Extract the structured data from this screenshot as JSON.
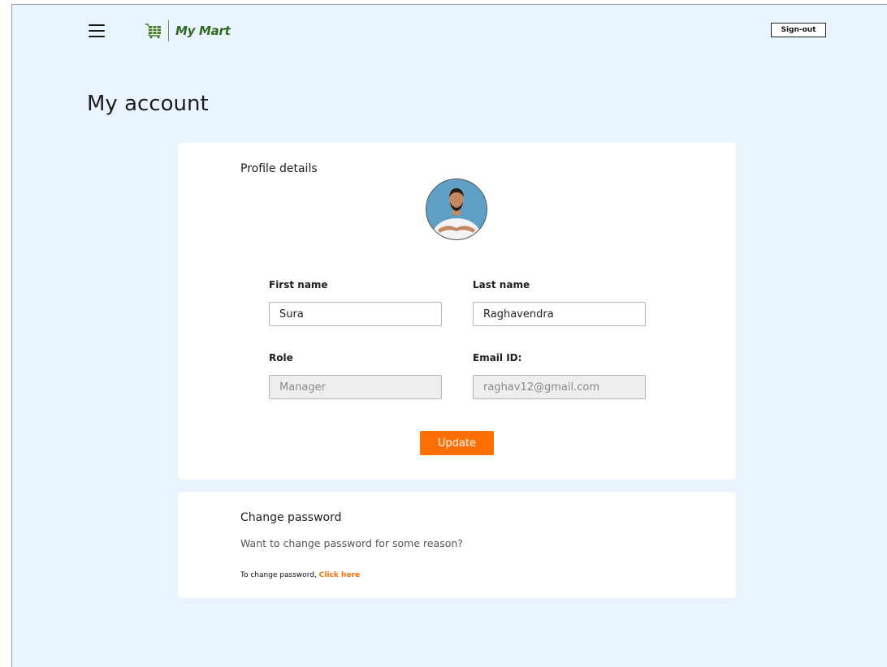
{
  "header": {
    "brand_name": "My Mart",
    "signout_label": "Sign-out",
    "icons": {
      "menu": "hamburger-icon",
      "logo": "shopping-cart-icon"
    },
    "colors": {
      "brand": "#2e6b1f"
    }
  },
  "page": {
    "title": "My account"
  },
  "profile": {
    "title": "Profile details",
    "avatar": "profile-photo",
    "fields": {
      "first_name": {
        "label": "First name",
        "value": "Sura"
      },
      "last_name": {
        "label": "Last name",
        "value": "Raghavendra"
      },
      "role": {
        "label": "Role",
        "value": "Manager"
      },
      "email": {
        "label": "Email ID:",
        "value": "raghav12@gmail.com"
      }
    },
    "update_label": "Update"
  },
  "password": {
    "title": "Change password",
    "description": "Want to change password for some reason?",
    "prompt": "To change password,",
    "link_label": "Click here"
  },
  "colors": {
    "accent": "#fd6f03",
    "background": "#eaf4fe",
    "card": "#ffffff"
  }
}
